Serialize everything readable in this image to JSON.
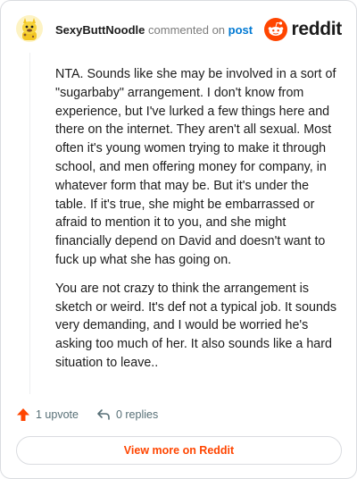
{
  "header": {
    "username": "SexyButtNoodle",
    "commented_on_text": "commented on",
    "post_link_text": "post",
    "brand_wordmark": "reddit"
  },
  "comment": {
    "paragraphs": [
      "NTA. Sounds like she may be involved in a sort of \"sugarbaby\" arrangement. I don't know from experience, but I've lurked a few things here and there on the internet. They aren't all sexual. Most often it's young women trying to make it through school, and men offering money for company, in whatever form that may be. But it's under the table. If it's true, she might be embarrassed or afraid to mention it to you, and she might financially depend on David and doesn't want to fuck up what she has going on.",
      "You are not crazy to think the arrangement is sketch or weird. It's def not a typical job. It sounds very demanding, and I would be worried he's asking too much of her. It also sounds like a hard situation to leave.."
    ]
  },
  "actions": {
    "upvote_label": "1 upvote",
    "replies_label": "0 replies"
  },
  "footer": {
    "view_more_label": "View more on Reddit"
  },
  "colors": {
    "accent": "#ff4500",
    "link": "#0079d3",
    "muted": "#7c7c7c"
  },
  "icons": {
    "avatar": "snoo-avatar",
    "brand": "reddit-logo-icon",
    "upvote": "upvote-arrow-icon",
    "reply": "reply-arrow-icon"
  }
}
